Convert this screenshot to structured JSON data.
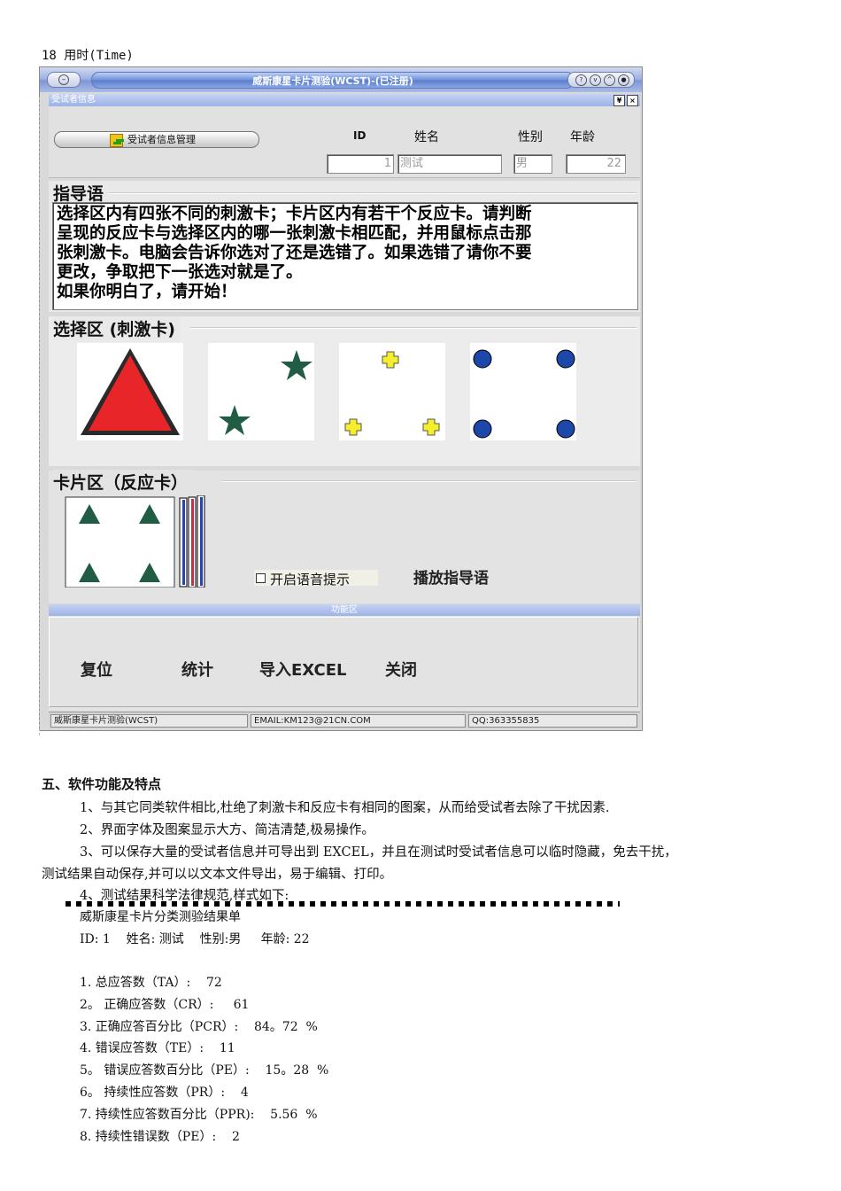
{
  "doc_header": "18 用时(Time)",
  "window": {
    "title": "威斯康星卡片测验(WCST)-(已注册)",
    "subject_panel": {
      "bar_label": "受试者信息",
      "manage_button": "受试者信息管理",
      "labels": {
        "id": "ID",
        "name": "姓名",
        "gender": "性别",
        "age": "年龄"
      },
      "values": {
        "id": "1",
        "name": "测试",
        "gender": "男",
        "age": "22"
      }
    },
    "instruction": {
      "title": "指导语",
      "lines": [
        "选择区内有四张不同的刺激卡；卡片区内有若干个反应卡。请判断",
        "呈现的反应卡与选择区内的哪一张刺激卡相匹配，并用鼠标点击那",
        "张刺激卡。电脑会告诉你选对了还是选错了。如果选错了请你不要",
        "更改，争取把下一张选对就是了。",
        "如果你明白了，请开始！"
      ]
    },
    "choice_area": {
      "title": "选择区 (刺激卡)",
      "cards": [
        {
          "count": 1,
          "shape": "triangle",
          "color": "#e8262a"
        },
        {
          "count": 2,
          "shape": "star",
          "color": "#215c45"
        },
        {
          "count": 3,
          "shape": "cross",
          "color": "#f5ef2b"
        },
        {
          "count": 4,
          "shape": "circle",
          "color": "#1d47a8"
        }
      ]
    },
    "response_area": {
      "title": "卡片区（反应卡）",
      "card": {
        "count": 4,
        "shape": "triangle",
        "color": "#215c45"
      },
      "voice_checkbox_label": "开启语音提示",
      "voice_checked": false,
      "play_instruction_label": "播放指导语"
    },
    "function_area": {
      "bar_label": "功能区",
      "buttons": [
        "复位",
        "统计",
        "导入EXCEL",
        "关闭"
      ]
    },
    "statusbar": [
      "威斯康星卡片测验(WCST)",
      "EMAIL:KM123@21CN.COM",
      "QQ:363355835"
    ]
  },
  "section": {
    "heading": "五、软件功能及特点",
    "items": [
      "1、与其它同类软件相比,杜绝了刺激卡和反应卡有相同的图案，从而给受试者去除了干扰因素.",
      "2、界面字体及图案显示大方、简洁清楚,极易操作。",
      "3、可以保存大量的受试者信息并可导出到 EXCEL，并且在测试时受试者信息可以临时隐藏，免去干扰，",
      "测试结果自动保存,并可以以文本文件导出，易于编辑、打印。",
      "4、测试结果科学法律规范,样式如下:"
    ]
  },
  "result_sheet": {
    "title": "威斯康星卡片分类测验结果单",
    "info": "ID: 1    姓名: 测试    性别:男     年龄: 22",
    "rows": [
      "1. 总应答数（TA）:    72",
      "2。 正确应答数（CR）:     61",
      "3. 正确应答百分比（PCR）:    84。72  %",
      "4. 错误应答数（TE）:    11",
      "5。 错误应答数百分比（PE）:    15。28  %",
      "6。 持续性应答数（PR）:    4",
      "7. 持续性应答数百分比（PPR):    5.56  %",
      "8. 持续性错误数（PE）:    2"
    ]
  }
}
